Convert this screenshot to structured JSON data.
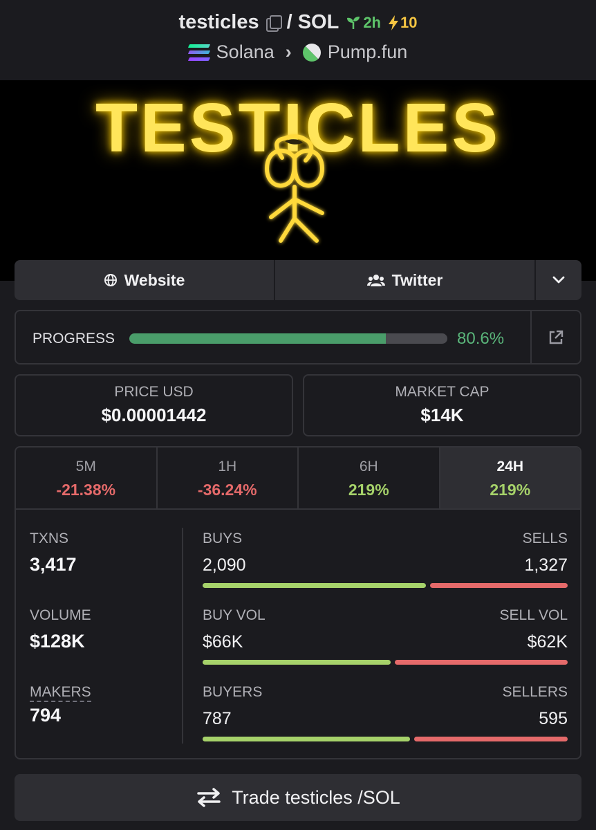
{
  "header": {
    "token": "testicles",
    "pair": "/ SOL",
    "age": "2h",
    "boosts": "10",
    "chain": "Solana",
    "dex": "Pump.fun"
  },
  "banner": {
    "title": "TESTICLES"
  },
  "links": {
    "website": "Website",
    "twitter": "Twitter"
  },
  "progress": {
    "label": "PROGRESS",
    "value_text": "80.6%",
    "value": 0.806
  },
  "price": {
    "label": "PRICE USD",
    "value": "$0.00001442"
  },
  "market_cap": {
    "label": "MARKET CAP",
    "value": "$14K"
  },
  "periods": [
    {
      "label": "5M",
      "change": "-21.38%",
      "direction": "down"
    },
    {
      "label": "1H",
      "change": "-36.24%",
      "direction": "down"
    },
    {
      "label": "6H",
      "change": "219%",
      "direction": "up"
    },
    {
      "label": "24H",
      "change": "219%",
      "direction": "up",
      "active": true
    }
  ],
  "metrics": {
    "txns": {
      "label": "TXNS",
      "value": "3,417"
    },
    "volume": {
      "label": "VOLUME",
      "value": "$128K"
    },
    "makers": {
      "label": "MAKERS",
      "value": "794"
    },
    "buys": {
      "label": "BUYS",
      "value": "2,090",
      "ratio": 0.612
    },
    "sells": {
      "label": "SELLS",
      "value": "1,327"
    },
    "buy_vol": {
      "label": "BUY VOL",
      "value": "$66K",
      "ratio": 0.516
    },
    "sell_vol": {
      "label": "SELL VOL",
      "value": "$62K"
    },
    "buyers": {
      "label": "BUYERS",
      "value": "787",
      "ratio": 0.569
    },
    "sellers": {
      "label": "SELLERS",
      "value": "595"
    }
  },
  "trade": {
    "label": "Trade testicles /SOL"
  },
  "colors": {
    "up": "#a6d26a",
    "down": "#e56a6a",
    "progress": "#4a9d6a",
    "accent_yellow": "#ffe55a"
  }
}
